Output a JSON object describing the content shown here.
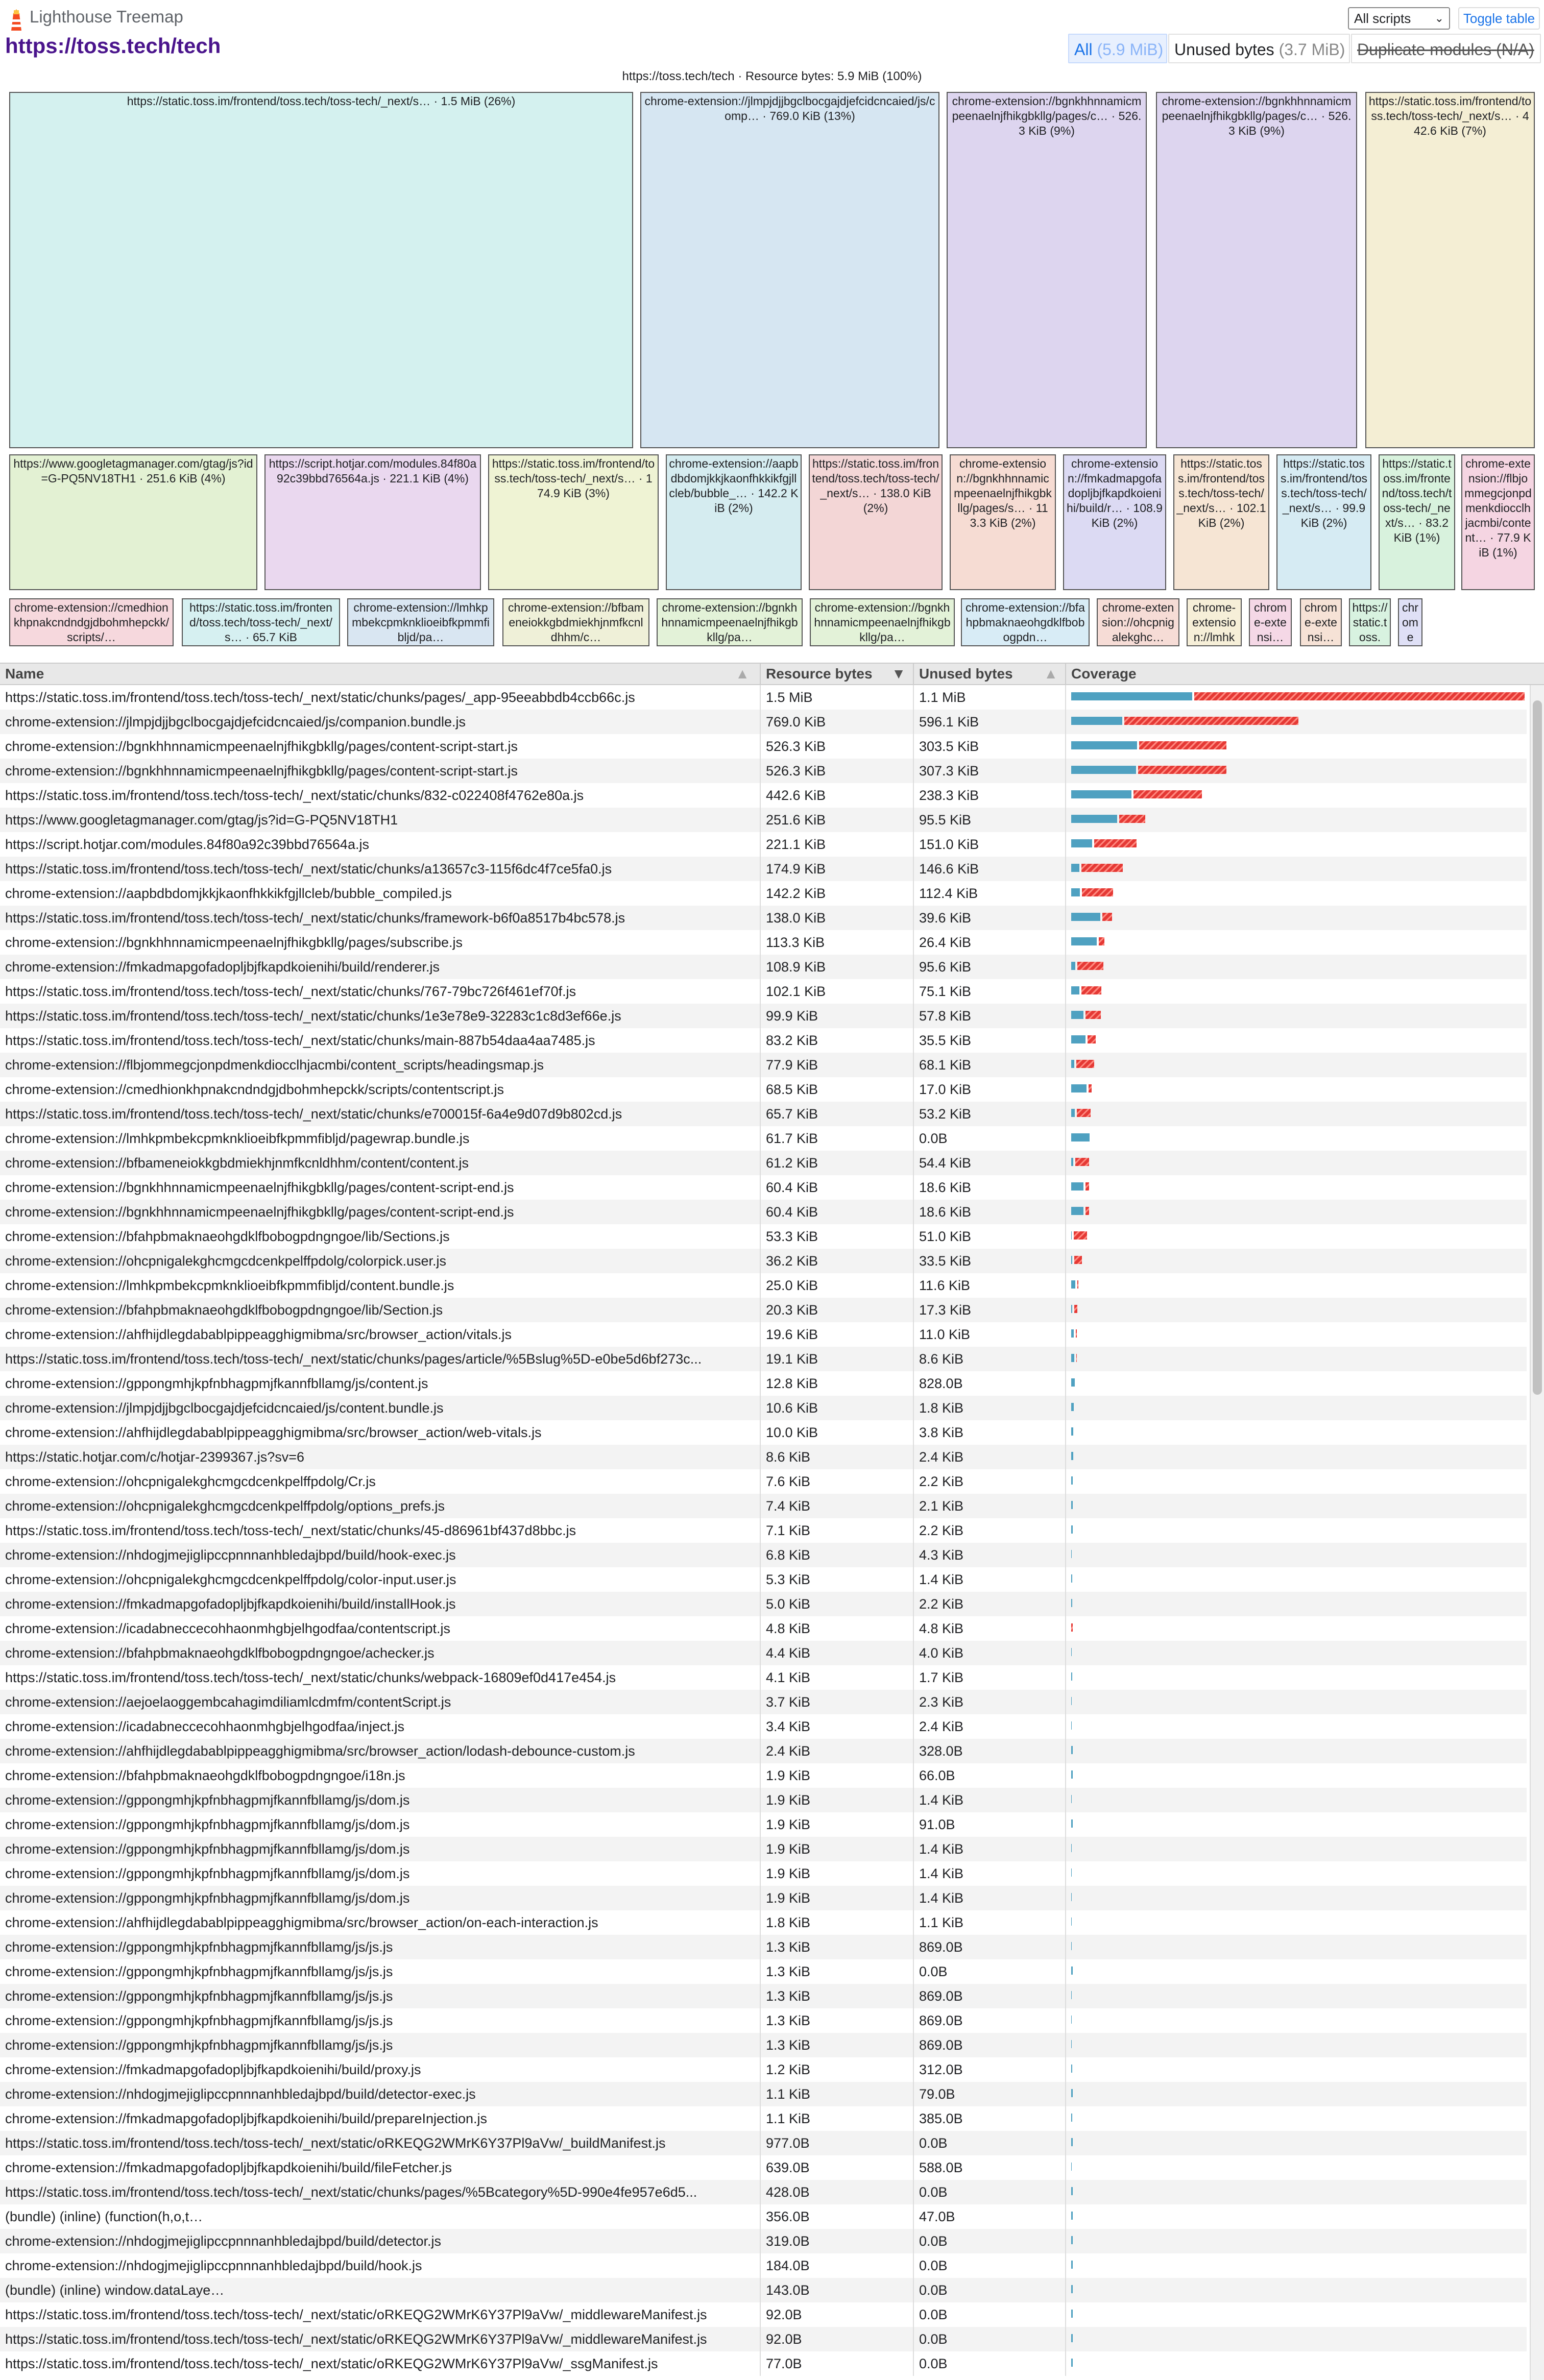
{
  "header": {
    "app_title": "Lighthouse Treemap",
    "url": "https://toss.tech/tech",
    "select_value": "All scripts",
    "toggle_label": "Toggle table",
    "views": [
      {
        "label": "All",
        "value": "(5.9 MiB)"
      },
      {
        "label": "Unused bytes",
        "value": "(3.7 MiB)"
      },
      {
        "label": "Duplicate modules",
        "value": "(N/A)"
      }
    ]
  },
  "treemap": {
    "root_label": "https://toss.tech/tech · Resource bytes: 5.9 MiB (100%)",
    "nodes": [
      {
        "label": "https://static.toss.im/frontend/toss.tech/toss-tech/_next/s… · 1.5 MiB (26%)",
        "color": "#d4f1ef"
      },
      {
        "label": "chrome-extension://jlmpjdjjbgclbocgajdjefcidcncaied/js/comp… · 769.0 KiB (13%)",
        "color": "#d6e6f2"
      },
      {
        "label": "chrome-extension://bgnkhhnnamicmpeenaelnjfhikgbkllg/pages/c… · 526.3 KiB (9%)",
        "color": "#ddd5ef"
      },
      {
        "label": "chrome-extension://bgnkhhnnamicmpeenaelnjfhikgbkllg/pages/c… · 526.3 KiB (9%)",
        "color": "#ddd5ef"
      },
      {
        "label": "https://static.toss.im/frontend/toss.tech/toss-tech/_next/s… · 442.6 KiB (7%)",
        "color": "#f4eed4"
      },
      {
        "label": "https://www.googletagmanager.com/gtag/js?id=G-PQ5NV18TH1 · 251.6 KiB (4%)",
        "color": "#e3f1d3"
      },
      {
        "label": "https://script.hotjar.com/modules.84f80a92c39bbd76564a.js · 221.1 KiB (4%)",
        "color": "#ead8ef"
      },
      {
        "label": "https://static.toss.im/frontend/toss.tech/toss-tech/_next/s… · 174.9 KiB (3%)",
        "color": "#eff3d4"
      },
      {
        "label": "chrome-extension://aapbdbdomjkkjkaonfhkkikfgjllcleb/bubble_… · 142.2 KiB (2%)",
        "color": "#d5ecf0"
      },
      {
        "label": "https://static.toss.im/frontend/toss.tech/toss-tech/_next/s… · 138.0 KiB (2%)",
        "color": "#f3d6d6"
      },
      {
        "label": "chrome-extension://bgnkhhnnamicmpeenaelnjfhikgbkllg/pages/s… · 113.3 KiB (2%)",
        "color": "#f6dcd3"
      },
      {
        "label": "chrome-extension://fmkadmapgofadopljbjfkapdkoienihi/build/r… · 108.9 KiB (2%)",
        "color": "#dcdaf3"
      },
      {
        "label": "https://static.toss.im/frontend/toss.tech/toss-tech/_next/s… · 102.1 KiB (2%)",
        "color": "#f6e5d4"
      },
      {
        "label": "https://static.toss.im/frontend/toss.tech/toss-tech/_next/s… · 99.9 KiB (2%)",
        "color": "#d6ebf3"
      },
      {
        "label": "https://static.toss.im/frontend/toss.tech/toss-tech/_next/s… · 83.2 KiB (1%)",
        "color": "#d8f2dd"
      },
      {
        "label": "chrome-extension://flbjommegcjonpdmenkdiocclhjacmbi/content… · 77.9 KiB (1%)",
        "color": "#f5d5e2"
      },
      {
        "label": "chrome-extension://cmedhionkhpnakcndndgjdbohmhepckk/scripts/…",
        "color": "#f6d8dd"
      },
      {
        "label": "https://static.toss.im/frontend/toss.tech/toss-tech/_next/s… · 65.7 KiB",
        "color": "#d6f0f1"
      },
      {
        "label": "chrome-extension://lmhkpmbekcpmknklioeibfkpmmfibljd/pa…",
        "color": "#d9e6f2"
      },
      {
        "label": "chrome-extension://bfbameneiokkgbdmiekhjnmfkcnldhhm/c…",
        "color": "#eff0d8"
      },
      {
        "label": "chrome-extension://bgnkhhnnamicmpeenaelnjfhikgbkllg/pa…",
        "color": "#e3f2d8"
      },
      {
        "label": "chrome-extension://bgnkhhnnamicmpeenaelnjfhikgbkllg/pa…",
        "color": "#e3f2d8"
      },
      {
        "label": "chrome-extension://bfahpbmaknaeohgdklfbobogpdn…",
        "color": "#d8ecf6"
      },
      {
        "label": "chrome-extension://ohcpnigalekghc…",
        "color": "#f6dcd6"
      },
      {
        "label": "chrome-extension://lmhkp…",
        "color": "#f6efd8"
      },
      {
        "label": "chrome-extensi…",
        "color": "#f5d8e6"
      },
      {
        "label": "chrome-extensi…",
        "color": "#f6e2d6"
      },
      {
        "label": "https://static.toss.i…",
        "color": "#d8f2e0"
      },
      {
        "label": "chrome-…",
        "color": "#dfe0f6"
      }
    ]
  },
  "table": {
    "columns": [
      "Name",
      "Resource bytes",
      "Unused bytes",
      "Coverage"
    ],
    "rows": [
      {
        "name": "https://static.toss.im/frontend/toss.tech/toss-tech/_next/static/chunks/pages/_app-95eeabbdb4ccb66c.js",
        "resource": "1.5 MiB",
        "unused": "1.1 MiB",
        "res_kib": 1536,
        "unused_kib": 1126
      },
      {
        "name": "chrome-extension://jlmpjdjjbgclbocgajdjefcidcncaied/js/companion.bundle.js",
        "resource": "769.0 KiB",
        "unused": "596.1 KiB",
        "res_kib": 769,
        "unused_kib": 596.1
      },
      {
        "name": "chrome-extension://bgnkhhnnamicmpeenaelnjfhikgbkllg/pages/content-script-start.js",
        "resource": "526.3 KiB",
        "unused": "303.5 KiB",
        "res_kib": 526.3,
        "unused_kib": 303.5
      },
      {
        "name": "chrome-extension://bgnkhhnnamicmpeenaelnjfhikgbkllg/pages/content-script-start.js",
        "resource": "526.3 KiB",
        "unused": "307.3 KiB",
        "res_kib": 526.3,
        "unused_kib": 307.3
      },
      {
        "name": "https://static.toss.im/frontend/toss.tech/toss-tech/_next/static/chunks/832-c022408f4762e80a.js",
        "resource": "442.6 KiB",
        "unused": "238.3 KiB",
        "res_kib": 442.6,
        "unused_kib": 238.3
      },
      {
        "name": "https://www.googletagmanager.com/gtag/js?id=G-PQ5NV18TH1",
        "resource": "251.6 KiB",
        "unused": "95.5 KiB",
        "res_kib": 251.6,
        "unused_kib": 95.5
      },
      {
        "name": "https://script.hotjar.com/modules.84f80a92c39bbd76564a.js",
        "resource": "221.1 KiB",
        "unused": "151.0 KiB",
        "res_kib": 221.1,
        "unused_kib": 151
      },
      {
        "name": "https://static.toss.im/frontend/toss.tech/toss-tech/_next/static/chunks/a13657c3-115f6dc4f7ce5fa0.js",
        "resource": "174.9 KiB",
        "unused": "146.6 KiB",
        "res_kib": 174.9,
        "unused_kib": 146.6
      },
      {
        "name": "chrome-extension://aapbdbdomjkkjkaonfhkkikfgjllcleb/bubble_compiled.js",
        "resource": "142.2 KiB",
        "unused": "112.4 KiB",
        "res_kib": 142.2,
        "unused_kib": 112.4
      },
      {
        "name": "https://static.toss.im/frontend/toss.tech/toss-tech/_next/static/chunks/framework-b6f0a8517b4bc578.js",
        "resource": "138.0 KiB",
        "unused": "39.6 KiB",
        "res_kib": 138,
        "unused_kib": 39.6
      },
      {
        "name": "chrome-extension://bgnkhhnnamicmpeenaelnjfhikgbkllg/pages/subscribe.js",
        "resource": "113.3 KiB",
        "unused": "26.4 KiB",
        "res_kib": 113.3,
        "unused_kib": 26.4
      },
      {
        "name": "chrome-extension://fmkadmapgofadopljbjfkapdkoienihi/build/renderer.js",
        "resource": "108.9 KiB",
        "unused": "95.6 KiB",
        "res_kib": 108.9,
        "unused_kib": 95.6
      },
      {
        "name": "https://static.toss.im/frontend/toss.tech/toss-tech/_next/static/chunks/767-79bc726f461ef70f.js",
        "resource": "102.1 KiB",
        "unused": "75.1 KiB",
        "res_kib": 102.1,
        "unused_kib": 75.1
      },
      {
        "name": "https://static.toss.im/frontend/toss.tech/toss-tech/_next/static/chunks/1e3e78e9-32283c1c8d3ef66e.js",
        "resource": "99.9 KiB",
        "unused": "57.8 KiB",
        "res_kib": 99.9,
        "unused_kib": 57.8
      },
      {
        "name": "https://static.toss.im/frontend/toss.tech/toss-tech/_next/static/chunks/main-887b54daa4aa7485.js",
        "resource": "83.2 KiB",
        "unused": "35.5 KiB",
        "res_kib": 83.2,
        "unused_kib": 35.5
      },
      {
        "name": "chrome-extension://flbjommegcjonpdmenkdiocclhjacmbi/content_scripts/headingsmap.js",
        "resource": "77.9 KiB",
        "unused": "68.1 KiB",
        "res_kib": 77.9,
        "unused_kib": 68.1
      },
      {
        "name": "chrome-extension://cmedhionkhpnakcndndgjdbohmhepckk/scripts/contentscript.js",
        "resource": "68.5 KiB",
        "unused": "17.0 KiB",
        "res_kib": 68.5,
        "unused_kib": 17
      },
      {
        "name": "https://static.toss.im/frontend/toss.tech/toss-tech/_next/static/chunks/e700015f-6a4e9d07d9b802cd.js",
        "resource": "65.7 KiB",
        "unused": "53.2 KiB",
        "res_kib": 65.7,
        "unused_kib": 53.2
      },
      {
        "name": "chrome-extension://lmhkpmbekcpmknklioeibfkpmmfibljd/pagewrap.bundle.js",
        "resource": "61.7 KiB",
        "unused": "0.0B",
        "res_kib": 61.7,
        "unused_kib": 0
      },
      {
        "name": "chrome-extension://bfbameneiokkgbdmiekhjnmfkcnldhhm/content/content.js",
        "resource": "61.2 KiB",
        "unused": "54.4 KiB",
        "res_kib": 61.2,
        "unused_kib": 54.4
      },
      {
        "name": "chrome-extension://bgnkhhnnamicmpeenaelnjfhikgbkllg/pages/content-script-end.js",
        "resource": "60.4 KiB",
        "unused": "18.6 KiB",
        "res_kib": 60.4,
        "unused_kib": 18.6
      },
      {
        "name": "chrome-extension://bgnkhhnnamicmpeenaelnjfhikgbkllg/pages/content-script-end.js",
        "resource": "60.4 KiB",
        "unused": "18.6 KiB",
        "res_kib": 60.4,
        "unused_kib": 18.6
      },
      {
        "name": "chrome-extension://bfahpbmaknaeohgdklfbobogpdngngoe/lib/Sections.js",
        "resource": "53.3 KiB",
        "unused": "51.0 KiB",
        "res_kib": 53.3,
        "unused_kib": 51
      },
      {
        "name": "chrome-extension://ohcpnigalekghcmgcdcenkpelffpdolg/colorpick.user.js",
        "resource": "36.2 KiB",
        "unused": "33.5 KiB",
        "res_kib": 36.2,
        "unused_kib": 33.5
      },
      {
        "name": "chrome-extension://lmhkpmbekcpmknklioeibfkpmmfibljd/content.bundle.js",
        "resource": "25.0 KiB",
        "unused": "11.6 KiB",
        "res_kib": 25,
        "unused_kib": 11.6
      },
      {
        "name": "chrome-extension://bfahpbmaknaeohgdklfbobogpdngngoe/lib/Section.js",
        "resource": "20.3 KiB",
        "unused": "17.3 KiB",
        "res_kib": 20.3,
        "unused_kib": 17.3
      },
      {
        "name": "chrome-extension://ahfhijdlegdabablpippeagghigmibma/src/browser_action/vitals.js",
        "resource": "19.6 KiB",
        "unused": "11.0 KiB",
        "res_kib": 19.6,
        "unused_kib": 11
      },
      {
        "name": "https://static.toss.im/frontend/toss.tech/toss-tech/_next/static/chunks/pages/article/%5Bslug%5D-e0be5d6bf273c...",
        "resource": "19.1 KiB",
        "unused": "8.6 KiB",
        "res_kib": 19.1,
        "unused_kib": 8.6
      },
      {
        "name": "chrome-extension://gppongmhjkpfnbhagpmjfkannfbllamg/js/content.js",
        "resource": "12.8 KiB",
        "unused": "828.0B",
        "res_kib": 12.8,
        "unused_kib": 0.81
      },
      {
        "name": "chrome-extension://jlmpjdjjbgclbocgajdjefcidcncaied/js/content.bundle.js",
        "resource": "10.6 KiB",
        "unused": "1.8 KiB",
        "res_kib": 10.6,
        "unused_kib": 1.8
      },
      {
        "name": "chrome-extension://ahfhijdlegdabablpippeagghigmibma/src/browser_action/web-vitals.js",
        "resource": "10.0 KiB",
        "unused": "3.8 KiB",
        "res_kib": 10,
        "unused_kib": 3.8
      },
      {
        "name": "https://static.hotjar.com/c/hotjar-2399367.js?sv=6",
        "resource": "8.6 KiB",
        "unused": "2.4 KiB",
        "res_kib": 8.6,
        "unused_kib": 2.4
      },
      {
        "name": "chrome-extension://ohcpnigalekghcmgcdcenkpelffpdolg/Cr.js",
        "resource": "7.6 KiB",
        "unused": "2.2 KiB",
        "res_kib": 7.6,
        "unused_kib": 2.2
      },
      {
        "name": "chrome-extension://ohcpnigalekghcmgcdcenkpelffpdolg/options_prefs.js",
        "resource": "7.4 KiB",
        "unused": "2.1 KiB",
        "res_kib": 7.4,
        "unused_kib": 2.1
      },
      {
        "name": "https://static.toss.im/frontend/toss.tech/toss-tech/_next/static/chunks/45-d86961bf437d8bbc.js",
        "resource": "7.1 KiB",
        "unused": "2.2 KiB",
        "res_kib": 7.1,
        "unused_kib": 2.2
      },
      {
        "name": "chrome-extension://nhdogjmejiglipccpnnnanhbledajbpd/build/hook-exec.js",
        "resource": "6.8 KiB",
        "unused": "4.3 KiB",
        "res_kib": 6.8,
        "unused_kib": 4.3
      },
      {
        "name": "chrome-extension://ohcpnigalekghcmgcdcenkpelffpdolg/color-input.user.js",
        "resource": "5.3 KiB",
        "unused": "1.4 KiB",
        "res_kib": 5.3,
        "unused_kib": 1.4
      },
      {
        "name": "chrome-extension://fmkadmapgofadopljbjfkapdkoienihi/build/installHook.js",
        "resource": "5.0 KiB",
        "unused": "2.2 KiB",
        "res_kib": 5,
        "unused_kib": 2.2
      },
      {
        "name": "chrome-extension://icadabneccecohhaonmhgbjelhgodfaa/contentscript.js",
        "resource": "4.8 KiB",
        "unused": "4.8 KiB",
        "res_kib": 4.8,
        "unused_kib": 4.8
      },
      {
        "name": "chrome-extension://bfahpbmaknaeohgdklfbobogpdngngoe/achecker.js",
        "resource": "4.4 KiB",
        "unused": "4.0 KiB",
        "res_kib": 4.4,
        "unused_kib": 4
      },
      {
        "name": "https://static.toss.im/frontend/toss.tech/toss-tech/_next/static/chunks/webpack-16809ef0d417e454.js",
        "resource": "4.1 KiB",
        "unused": "1.7 KiB",
        "res_kib": 4.1,
        "unused_kib": 1.7
      },
      {
        "name": "chrome-extension://aejoelaoggembcahagimdiliamlcdmfm/contentScript.js",
        "resource": "3.7 KiB",
        "unused": "2.3 KiB",
        "res_kib": 3.7,
        "unused_kib": 2.3
      },
      {
        "name": "chrome-extension://icadabneccecohhaonmhgbjelhgodfaa/inject.js",
        "resource": "3.4 KiB",
        "unused": "2.4 KiB",
        "res_kib": 3.4,
        "unused_kib": 2.4
      },
      {
        "name": "chrome-extension://ahfhijdlegdabablpippeagghigmibma/src/browser_action/lodash-debounce-custom.js",
        "resource": "2.4 KiB",
        "unused": "328.0B",
        "res_kib": 2.4,
        "unused_kib": 0.32
      },
      {
        "name": "chrome-extension://bfahpbmaknaeohgdklfbobogpdngngoe/i18n.js",
        "resource": "1.9 KiB",
        "unused": "66.0B",
        "res_kib": 1.9,
        "unused_kib": 0.06
      },
      {
        "name": "chrome-extension://gppongmhjkpfnbhagpmjfkannfbllamg/js/dom.js",
        "resource": "1.9 KiB",
        "unused": "1.4 KiB",
        "res_kib": 1.9,
        "unused_kib": 1.4
      },
      {
        "name": "chrome-extension://gppongmhjkpfnbhagpmjfkannfbllamg/js/dom.js",
        "resource": "1.9 KiB",
        "unused": "91.0B",
        "res_kib": 1.9,
        "unused_kib": 0.09
      },
      {
        "name": "chrome-extension://gppongmhjkpfnbhagpmjfkannfbllamg/js/dom.js",
        "resource": "1.9 KiB",
        "unused": "1.4 KiB",
        "res_kib": 1.9,
        "unused_kib": 1.4
      },
      {
        "name": "chrome-extension://gppongmhjkpfnbhagpmjfkannfbllamg/js/dom.js",
        "resource": "1.9 KiB",
        "unused": "1.4 KiB",
        "res_kib": 1.9,
        "unused_kib": 1.4
      },
      {
        "name": "chrome-extension://gppongmhjkpfnbhagpmjfkannfbllamg/js/dom.js",
        "resource": "1.9 KiB",
        "unused": "1.4 KiB",
        "res_kib": 1.9,
        "unused_kib": 1.4
      },
      {
        "name": "chrome-extension://ahfhijdlegdabablpippeagghigmibma/src/browser_action/on-each-interaction.js",
        "resource": "1.8 KiB",
        "unused": "1.1 KiB",
        "res_kib": 1.8,
        "unused_kib": 1.1
      },
      {
        "name": "chrome-extension://gppongmhjkpfnbhagpmjfkannfbllamg/js/js.js",
        "resource": "1.3 KiB",
        "unused": "869.0B",
        "res_kib": 1.3,
        "unused_kib": 0.85
      },
      {
        "name": "chrome-extension://gppongmhjkpfnbhagpmjfkannfbllamg/js/js.js",
        "resource": "1.3 KiB",
        "unused": "0.0B",
        "res_kib": 1.3,
        "unused_kib": 0
      },
      {
        "name": "chrome-extension://gppongmhjkpfnbhagpmjfkannfbllamg/js/js.js",
        "resource": "1.3 KiB",
        "unused": "869.0B",
        "res_kib": 1.3,
        "unused_kib": 0.85
      },
      {
        "name": "chrome-extension://gppongmhjkpfnbhagpmjfkannfbllamg/js/js.js",
        "resource": "1.3 KiB",
        "unused": "869.0B",
        "res_kib": 1.3,
        "unused_kib": 0.85
      },
      {
        "name": "chrome-extension://gppongmhjkpfnbhagpmjfkannfbllamg/js/js.js",
        "resource": "1.3 KiB",
        "unused": "869.0B",
        "res_kib": 1.3,
        "unused_kib": 0.85
      },
      {
        "name": "chrome-extension://fmkadmapgofadopljbjfkapdkoienihi/build/proxy.js",
        "resource": "1.2 KiB",
        "unused": "312.0B",
        "res_kib": 1.2,
        "unused_kib": 0.3
      },
      {
        "name": "chrome-extension://nhdogjmejiglipccpnnnanhbledajbpd/build/detector-exec.js",
        "resource": "1.1 KiB",
        "unused": "79.0B",
        "res_kib": 1.1,
        "unused_kib": 0.08
      },
      {
        "name": "chrome-extension://fmkadmapgofadopljbjfkapdkoienihi/build/prepareInjection.js",
        "resource": "1.1 KiB",
        "unused": "385.0B",
        "res_kib": 1.1,
        "unused_kib": 0.38
      },
      {
        "name": "https://static.toss.im/frontend/toss.tech/toss-tech/_next/static/oRKEQG2WMrK6Y37Pl9aVw/_buildManifest.js",
        "resource": "977.0B",
        "unused": "0.0B",
        "res_kib": 0.95,
        "unused_kib": 0
      },
      {
        "name": "chrome-extension://fmkadmapgofadopljbjfkapdkoienihi/build/fileFetcher.js",
        "resource": "639.0B",
        "unused": "588.0B",
        "res_kib": 0.62,
        "unused_kib": 0.57
      },
      {
        "name": "https://static.toss.im/frontend/toss.tech/toss-tech/_next/static/chunks/pages/%5Bcategory%5D-990e4fe957e6d5...",
        "resource": "428.0B",
        "unused": "0.0B",
        "res_kib": 0.42,
        "unused_kib": 0
      },
      {
        "name": "(bundle) (inline) (function(h,o,t…",
        "resource": "356.0B",
        "unused": "47.0B",
        "res_kib": 0.35,
        "unused_kib": 0.05
      },
      {
        "name": "chrome-extension://nhdogjmejiglipccpnnnanhbledajbpd/build/detector.js",
        "resource": "319.0B",
        "unused": "0.0B",
        "res_kib": 0.31,
        "unused_kib": 0
      },
      {
        "name": "chrome-extension://nhdogjmejiglipccpnnnanhbledajbpd/build/hook.js",
        "resource": "184.0B",
        "unused": "0.0B",
        "res_kib": 0.18,
        "unused_kib": 0
      },
      {
        "name": "(bundle) (inline) window.dataLaye…",
        "resource": "143.0B",
        "unused": "0.0B",
        "res_kib": 0.14,
        "unused_kib": 0
      },
      {
        "name": "https://static.toss.im/frontend/toss.tech/toss-tech/_next/static/oRKEQG2WMrK6Y37Pl9aVw/_middlewareManifest.js",
        "resource": "92.0B",
        "unused": "0.0B",
        "res_kib": 0.09,
        "unused_kib": 0
      },
      {
        "name": "https://static.toss.im/frontend/toss.tech/toss-tech/_next/static/oRKEQG2WMrK6Y37Pl9aVw/_middlewareManifest.js",
        "resource": "92.0B",
        "unused": "0.0B",
        "res_kib": 0.09,
        "unused_kib": 0
      },
      {
        "name": "https://static.toss.im/frontend/toss.tech/toss-tech/_next/static/oRKEQG2WMrK6Y37Pl9aVw/_ssgManifest.js",
        "resource": "77.0B",
        "unused": "0.0B",
        "res_kib": 0.08,
        "unused_kib": 0
      }
    ]
  }
}
